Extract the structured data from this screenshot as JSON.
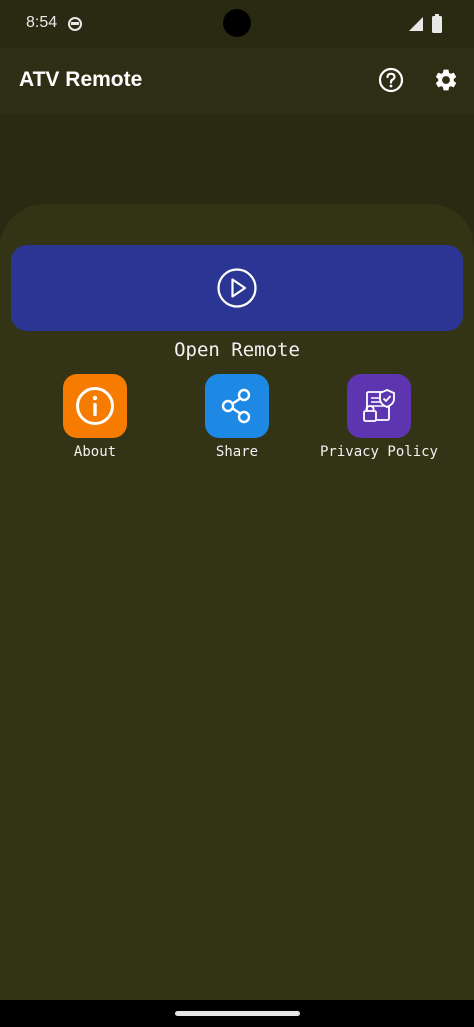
{
  "status_bar": {
    "time": "8:54",
    "app_icon": "app-notification-icon",
    "signal_icon": "signal-icon",
    "battery_icon": "battery-icon"
  },
  "app_bar": {
    "title": "ATV Remote",
    "help_icon": "help-icon",
    "settings_icon": "gear-icon"
  },
  "main": {
    "open_remote_icon": "play-icon",
    "open_remote_label": "Open Remote",
    "actions": [
      {
        "label": "About",
        "icon": "info-icon",
        "color": "#f57c00"
      },
      {
        "label": "Share",
        "icon": "share-icon",
        "color": "#1e88e5"
      },
      {
        "label": "Privacy Policy",
        "icon": "privacy-policy-icon",
        "color": "#5e35b1"
      }
    ]
  },
  "colors": {
    "background": "#2a2a12",
    "sheet": "#333316",
    "primary_button": "#2b3593"
  }
}
